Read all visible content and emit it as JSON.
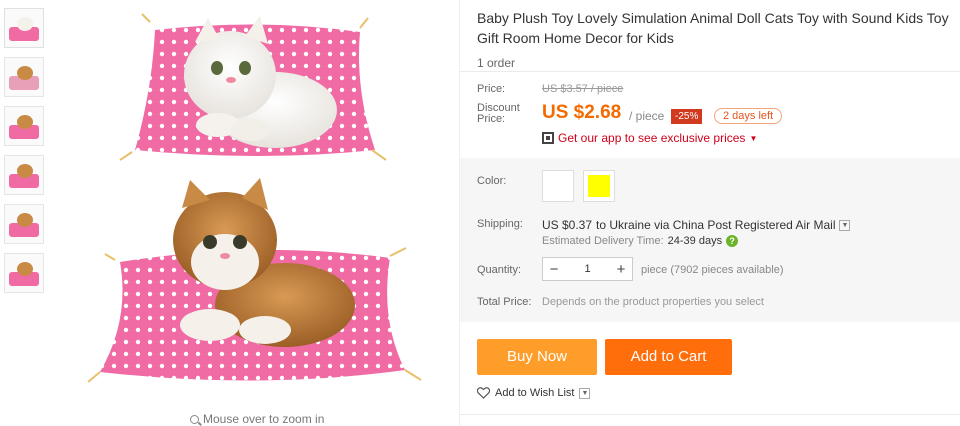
{
  "thumbnails": [
    {
      "label": "thumbnail-1"
    },
    {
      "label": "thumbnail-2"
    },
    {
      "label": "thumbnail-3"
    },
    {
      "label": "thumbnail-4"
    },
    {
      "label": "thumbnail-5"
    },
    {
      "label": "thumbnail-6"
    }
  ],
  "gallery": {
    "zoom_hint": "Mouse over to zoom in"
  },
  "product": {
    "title": "Baby Plush Toy Lovely Simulation Animal Doll Cats Toy with Sound Kids Toy Gift Room Home Decor for Kids",
    "orders": "1 order"
  },
  "price": {
    "price_label": "Price:",
    "old_price": "US $3.57 / piece",
    "discount_label": "Discount Price:",
    "current_price": "US $2.68",
    "per_piece": "/ piece",
    "discount_badge": "-25%",
    "days_left": "2 days left",
    "app_link": "Get our app to see exclusive prices"
  },
  "options": {
    "color_label": "Color:",
    "colors": [
      {
        "name": "white",
        "hex": "#ffffff"
      },
      {
        "name": "yellow",
        "hex": "#ffff00"
      }
    ],
    "shipping_label": "Shipping:",
    "shipping_price": "US $0.37",
    "shipping_text": "to Ukraine via China Post Registered Air Mail",
    "estimated_label": "Estimated Delivery Time:",
    "estimated_days": "24-39 days",
    "quantity_label": "Quantity:",
    "quantity_value": "1",
    "quantity_note": "piece (7902 pieces available)",
    "total_label": "Total Price:",
    "total_note": "Depends on the product properties you select"
  },
  "actions": {
    "buy_now": "Buy Now",
    "add_to_cart": "Add to Cart",
    "wish_list": "Add to Wish List"
  },
  "colors": {
    "accent_price": "#f56a00",
    "buy_now": "#ff9d2a",
    "add_to_cart": "#ff6e0b",
    "discount_badge": "#d13a1f",
    "cushion_pink": "#f06aa4"
  }
}
